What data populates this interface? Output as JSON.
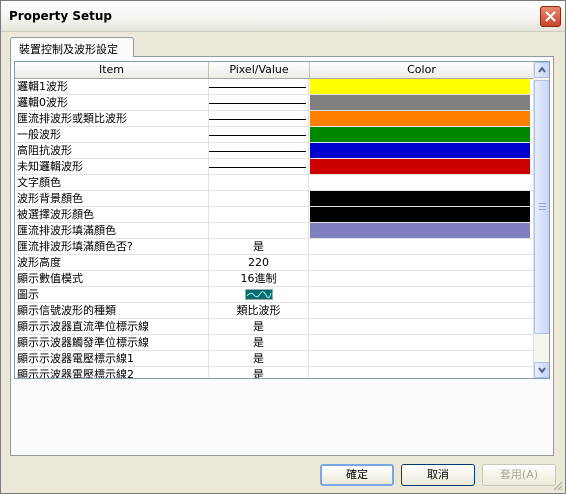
{
  "window": {
    "title": "Property Setup"
  },
  "tabs": [
    {
      "label": "裝置控制及波形設定"
    }
  ],
  "grid": {
    "columns": [
      "Item",
      "Pixel/Value",
      "Color"
    ],
    "rows": [
      {
        "item": "邏輯1波形",
        "value": "",
        "line": true,
        "color": "#ffff00"
      },
      {
        "item": "邏輯0波形",
        "value": "",
        "line": true,
        "color": "#808080"
      },
      {
        "item": "匯流排波形或類比波形",
        "value": "",
        "line": true,
        "color": "#ff8000"
      },
      {
        "item": "一般波形",
        "value": "",
        "line": true,
        "color": "#008800"
      },
      {
        "item": "高阻抗波形",
        "value": "",
        "line": true,
        "color": "#0000cc"
      },
      {
        "item": "未知邏輯波形",
        "value": "",
        "line": true,
        "color": "#cc0000"
      },
      {
        "item": "文字顏色",
        "value": "",
        "line": false,
        "color": ""
      },
      {
        "item": "波形背景顏色",
        "value": "",
        "line": false,
        "color": "#000000"
      },
      {
        "item": "被選擇波形顏色",
        "value": "",
        "line": false,
        "color": "#000000"
      },
      {
        "item": "匯流排波形填滿顏色",
        "value": "",
        "line": false,
        "color": "#8080c0"
      },
      {
        "item": "匯流排波形填滿顏色否?",
        "value": "是",
        "line": false,
        "color": ""
      },
      {
        "item": "波形高度",
        "value": "220",
        "line": false,
        "color": ""
      },
      {
        "item": "顯示數值模式",
        "value": "16進制",
        "line": false,
        "color": ""
      },
      {
        "item": "圖示",
        "value": "",
        "line": false,
        "icon": true,
        "color": ""
      },
      {
        "item": "顯示信號波形的種類",
        "value": "類比波形",
        "line": false,
        "color": ""
      },
      {
        "item": "顯示示波器直流準位標示線",
        "value": "是",
        "line": false,
        "color": ""
      },
      {
        "item": "顯示示波器觸發準位標示線",
        "value": "是",
        "line": false,
        "color": ""
      },
      {
        "item": "顯示示波器電壓標示線1",
        "value": "是",
        "line": false,
        "color": ""
      },
      {
        "item": "顯示示波器電壓標示線2",
        "value": "是",
        "line": false,
        "color": ""
      }
    ]
  },
  "buttons": {
    "ok": "確定",
    "cancel": "取消",
    "apply": "套用(A)"
  }
}
